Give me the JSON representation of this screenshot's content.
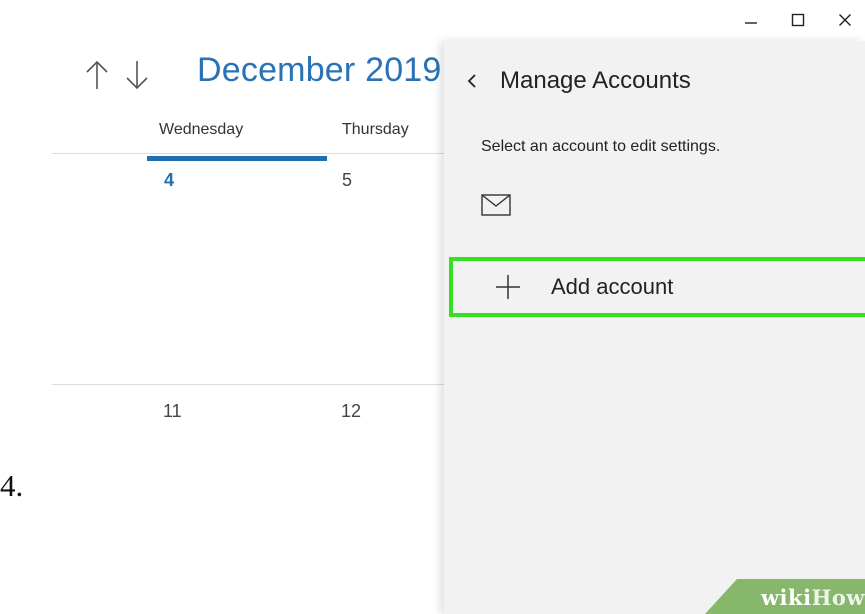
{
  "window_controls": {
    "icons": [
      "minimize-icon",
      "maximize-icon",
      "close-icon"
    ]
  },
  "calendar": {
    "month_title": "December 2019",
    "nav_icons": [
      "arrow-up-icon",
      "arrow-down-icon"
    ],
    "day_names": [
      "Wednesday",
      "Thursday"
    ],
    "dates": [
      "4",
      "5",
      "11",
      "12"
    ],
    "today": "4",
    "accent_color": "#1f6fb4"
  },
  "step": {
    "number": "4."
  },
  "panel": {
    "title": "Manage Accounts",
    "back_icon": "chevron-left-icon",
    "description": "Select an account to edit settings.",
    "account_icon": "mail-icon",
    "add_account_label": "Add account",
    "add_icon": "plus-icon",
    "highlight_color": "#36e025",
    "background": "#f2f2f2"
  },
  "watermark": {
    "text_a": "wiki",
    "text_b": "How"
  }
}
